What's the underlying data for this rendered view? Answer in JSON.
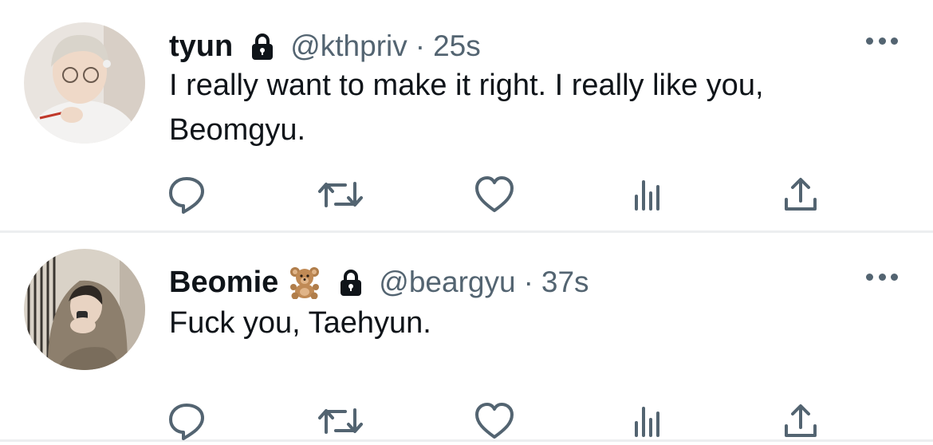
{
  "tweets": [
    {
      "name": "tyun",
      "handle": "@kthpriv",
      "separator": "·",
      "time": "25s",
      "text": "I really want to make it right. I really like you, Beomgyu.",
      "avatar_icon": "avatar-photo",
      "verified_icon": "lock-icon"
    },
    {
      "name": "Beomie",
      "emoji": "teddy-bear",
      "handle": "@beargyu",
      "separator": "·",
      "time": "37s",
      "text": "Fuck you, Taehyun.",
      "avatar_icon": "avatar-photo",
      "verified_icon": "lock-icon"
    }
  ],
  "colors": {
    "text": "#0f1419",
    "secondary": "#536471",
    "divider": "#eceef0"
  },
  "actions": [
    "reply-icon",
    "retweet-icon",
    "like-icon",
    "views-icon",
    "share-icon"
  ]
}
